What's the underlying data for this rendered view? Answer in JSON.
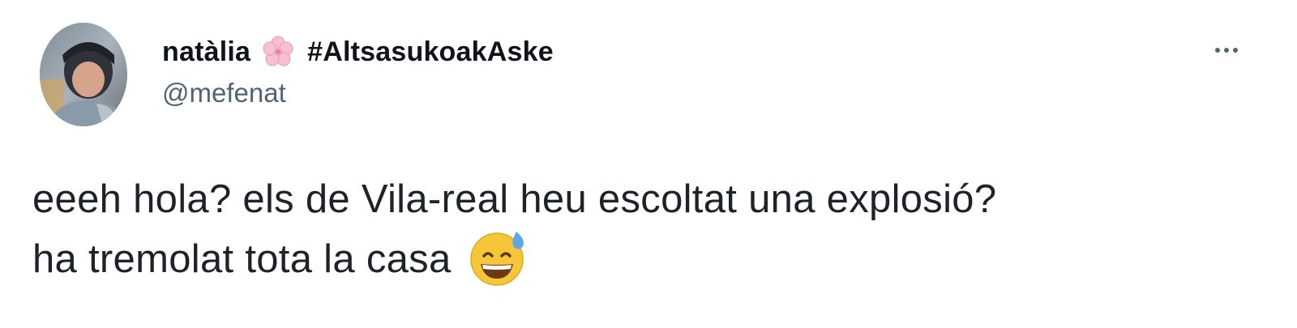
{
  "tweet": {
    "author": {
      "display_name": "natàlia",
      "name_emoji": "flower-icon",
      "hashtag": "#AltsasukoakAske",
      "handle": "@mefenat",
      "avatar": "avatar-photo"
    },
    "more_icon": "more-options-icon",
    "text_line_1": "eeeh hola? els de Vila-real heu escoltat una explosió?",
    "text_line_2": "ha tremolat tota la casa",
    "text_emoji": "grinning-face-with-sweat-icon",
    "colors": {
      "text": "#0f1419",
      "secondary": "#536471",
      "emoji_face": "#f5c53a",
      "emoji_sweat": "#5fa8e6",
      "flower": "#f4b6c6"
    }
  }
}
